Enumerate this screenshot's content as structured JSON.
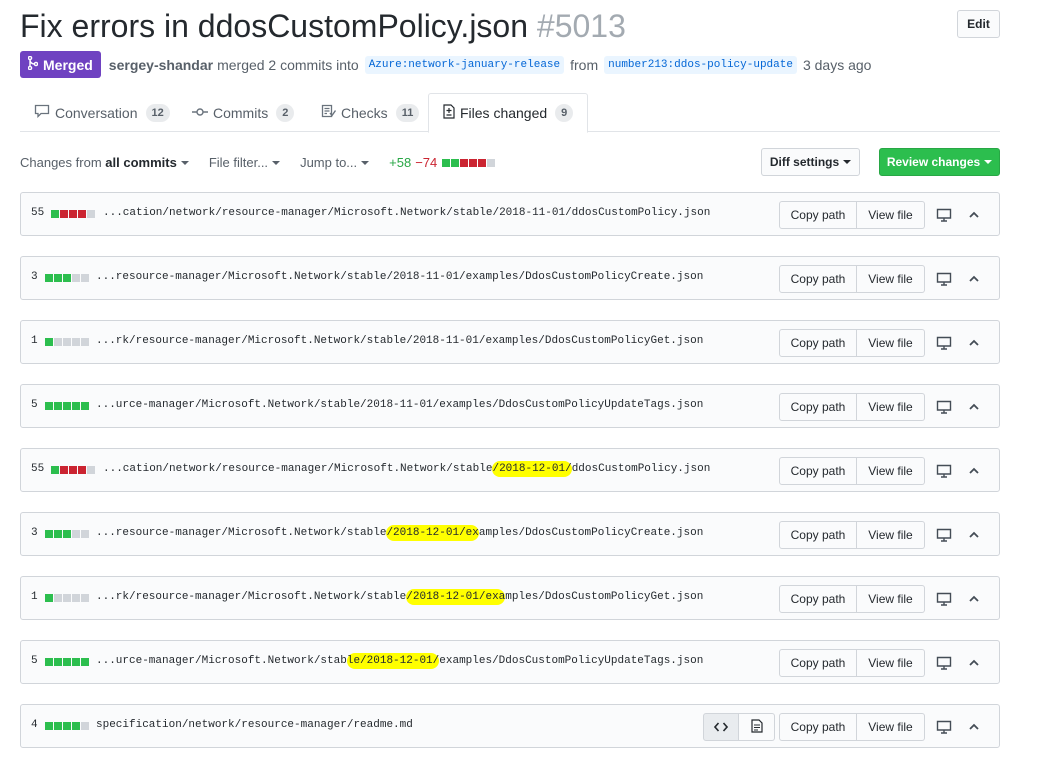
{
  "pr": {
    "title": "Fix errors in ddosCustomPolicy.json",
    "number": "#5013",
    "edit_label": "Edit",
    "state_label": "Merged",
    "author": "sergey-shandar",
    "action_text": "merged 2 commits into",
    "base_branch": "Azure:network-january-release",
    "from_text": "from",
    "head_branch": "number213:ddos-policy-update",
    "time_ago": "3 days ago"
  },
  "tabs": [
    {
      "label": "Conversation",
      "count": "12",
      "icon": "comment-icon"
    },
    {
      "label": "Commits",
      "count": "2",
      "icon": "commit-icon"
    },
    {
      "label": "Checks",
      "count": "11",
      "icon": "checklist-icon"
    },
    {
      "label": "Files changed",
      "count": "9",
      "icon": "file-diff-icon"
    }
  ],
  "toolbar": {
    "changes_from_prefix": "Changes from",
    "changes_from_value": "all commits",
    "file_filter": "File filter...",
    "jump_to": "Jump to...",
    "additions": "+58",
    "deletions": "−74",
    "diff_settings": "Diff settings",
    "review_changes": "Review changes"
  },
  "file_buttons": {
    "copy_path": "Copy path",
    "view_file": "View file"
  },
  "colors": {
    "merged": "#6f42c1",
    "addition": "#2cbe4e",
    "deletion": "#cb2431",
    "neutral": "#d1d5da",
    "highlight": "#ffff00",
    "review_button": "#2cbe4e"
  },
  "files": [
    {
      "count": "55",
      "bar": [
        "g",
        "r",
        "r",
        "r",
        "n"
      ],
      "path_pre": "...cation/network/resource-manager/Microsoft.Network/stable/2018-11-01/ddosCustomPolicy.json",
      "path_hl": "",
      "path_post": ""
    },
    {
      "count": "3",
      "bar": [
        "g",
        "g",
        "g",
        "n",
        "n"
      ],
      "path_pre": "...resource-manager/Microsoft.Network/stable/2018-11-01/examples/DdosCustomPolicyCreate.json",
      "path_hl": "",
      "path_post": ""
    },
    {
      "count": "1",
      "bar": [
        "g",
        "n",
        "n",
        "n",
        "n"
      ],
      "path_pre": "...rk/resource-manager/Microsoft.Network/stable/2018-11-01/examples/DdosCustomPolicyGet.json",
      "path_hl": "",
      "path_post": ""
    },
    {
      "count": "5",
      "bar": [
        "g",
        "g",
        "g",
        "g",
        "g"
      ],
      "path_pre": "...urce-manager/Microsoft.Network/stable/2018-11-01/examples/DdosCustomPolicyUpdateTags.json",
      "path_hl": "",
      "path_post": ""
    },
    {
      "count": "55",
      "bar": [
        "g",
        "r",
        "r",
        "r",
        "n"
      ],
      "path_pre": "...cation/network/resource-manager/Microsoft.Network/stable",
      "path_hl": "/2018-12-01/",
      "path_post": "ddosCustomPolicy.json"
    },
    {
      "count": "3",
      "bar": [
        "g",
        "g",
        "g",
        "n",
        "n"
      ],
      "path_pre": "...resource-manager/Microsoft.Network/stable",
      "path_hl": "/2018-12-01/ex",
      "path_post": "amples/DdosCustomPolicyCreate.json"
    },
    {
      "count": "1",
      "bar": [
        "g",
        "n",
        "n",
        "n",
        "n"
      ],
      "path_pre": "...rk/resource-manager/Microsoft.Network/stable",
      "path_hl": "/2018-12-01/exa",
      "path_post": "mples/DdosCustomPolicyGet.json"
    },
    {
      "count": "5",
      "bar": [
        "g",
        "g",
        "g",
        "g",
        "g"
      ],
      "path_pre": "...urce-manager/Microsoft.Network/stab",
      "path_hl": "le/2018-12-01/",
      "path_post": "examples/DdosCustomPolicyUpdateTags.json"
    },
    {
      "count": "4",
      "bar": [
        "g",
        "g",
        "g",
        "g",
        "n"
      ],
      "path_pre": "specification/network/resource-manager/readme.md",
      "path_hl": "",
      "path_post": "",
      "has_toggle": true
    }
  ]
}
